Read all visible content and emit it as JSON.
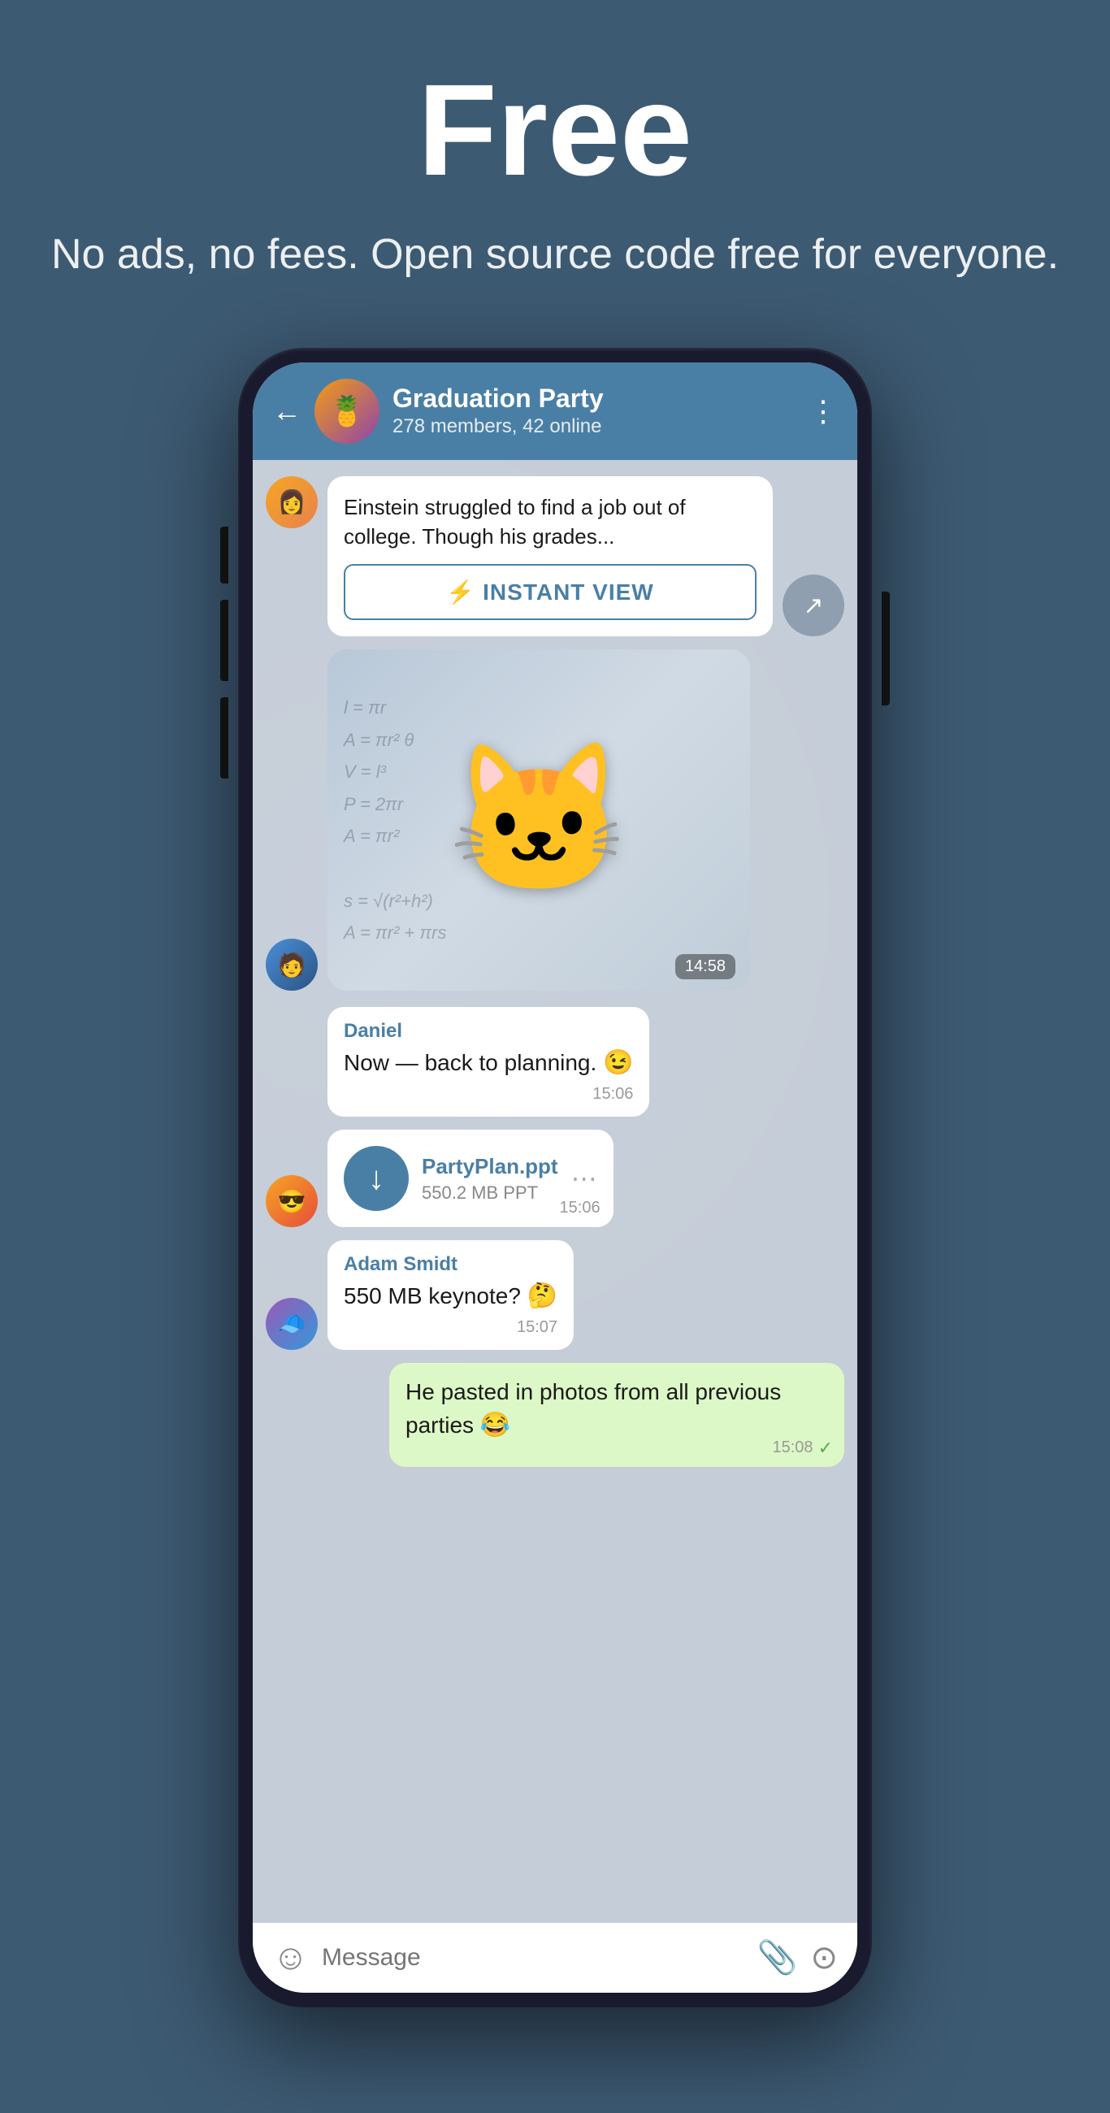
{
  "header": {
    "title": "Free",
    "subtitle": "No ads, no fees. Open source code free for everyone."
  },
  "chat": {
    "name": "Graduation Party",
    "members": "278 members, 42 online",
    "avatar_emoji": "🍍",
    "back_label": "←",
    "more_label": "⋮"
  },
  "messages": [
    {
      "id": "article",
      "type": "article",
      "text": "Einstein struggled to find a job out of college. Though his grades...",
      "instant_view_label": "INSTANT VIEW",
      "avatar_type": "girl"
    },
    {
      "id": "sticker",
      "type": "sticker",
      "time": "14:58",
      "avatar_type": "boy1"
    },
    {
      "id": "daniel-msg",
      "type": "text",
      "sender": "Daniel",
      "text": "Now — back to planning. 😉",
      "time": "15:06",
      "avatar_type": "none"
    },
    {
      "id": "file",
      "type": "file",
      "filename": "PartyPlan.ppt",
      "filesize": "550.2 MB PPT",
      "time": "15:06",
      "avatar_type": "boy2"
    },
    {
      "id": "adam-msg",
      "type": "text",
      "sender": "Adam Smidt",
      "text": "550 MB keynote? 🤔",
      "time": "15:07",
      "avatar_type": "hat"
    },
    {
      "id": "my-msg",
      "type": "text_self",
      "text": "He pasted in photos from all previous parties 😂",
      "time": "15:08",
      "checkmark": "✓"
    }
  ],
  "input_bar": {
    "placeholder": "Message"
  },
  "icons": {
    "back": "←",
    "more": "⋮",
    "lightning": "⚡",
    "download": "↓",
    "share": "↗",
    "emoji": "☺",
    "attach": "📎",
    "camera": "📷"
  }
}
